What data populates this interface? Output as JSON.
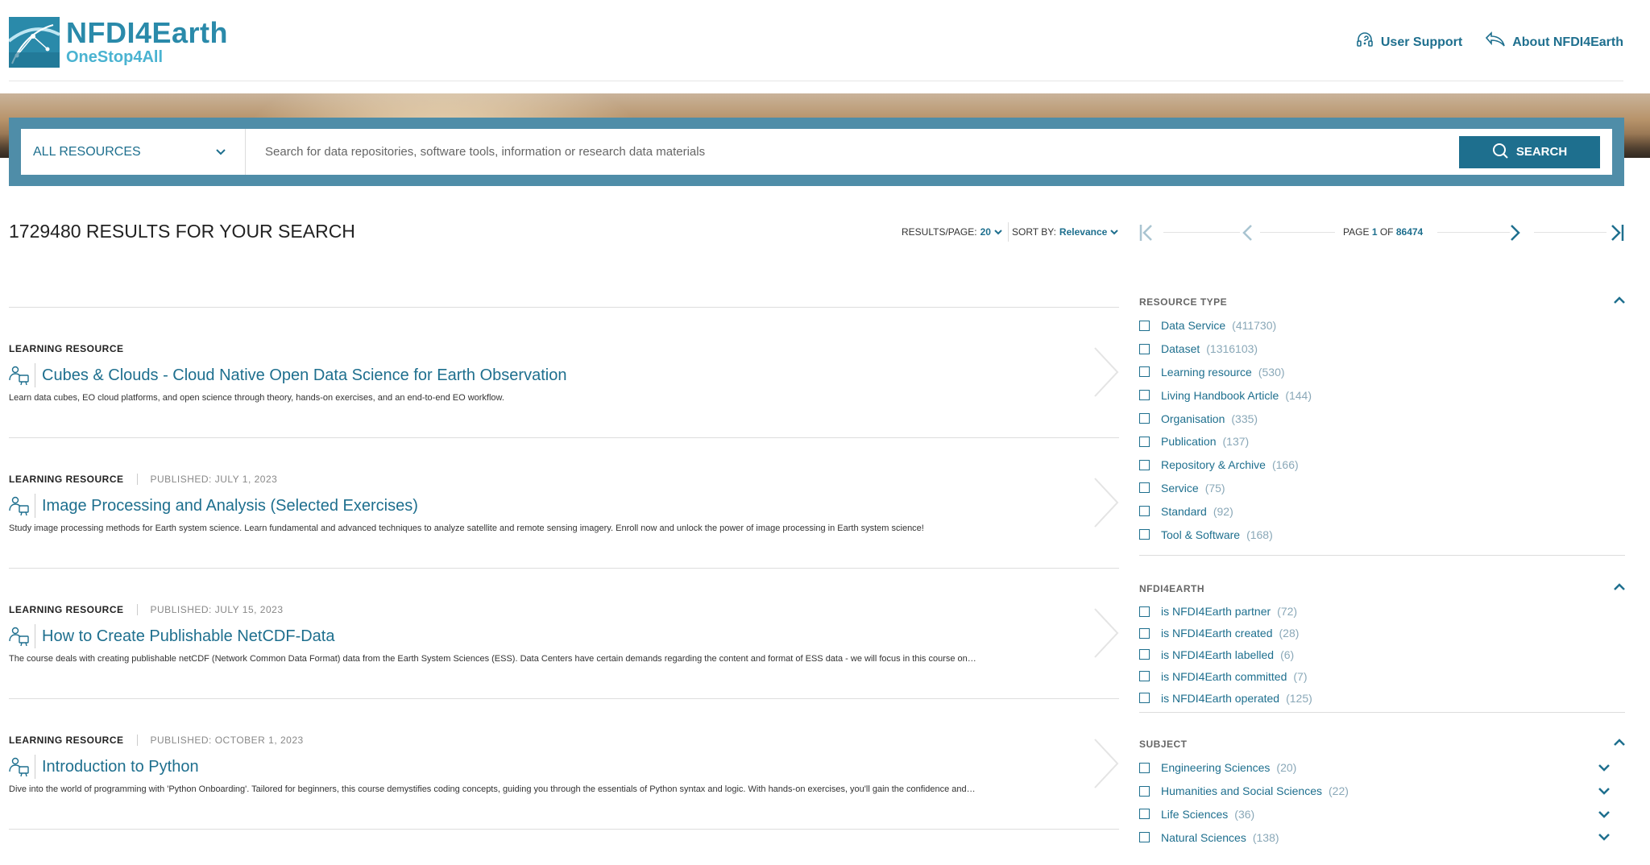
{
  "brand": {
    "name": "NFDI4Earth",
    "sub": "OneStop4All"
  },
  "nav": [
    {
      "label": "User Support",
      "icon": "headset-icon"
    },
    {
      "label": "About NFDI4Earth",
      "icon": "share-arrow-icon"
    }
  ],
  "search": {
    "scope": "ALL RESOURCES",
    "placeholder": "Search for data repositories, software tools, information or research data materials",
    "button": "SEARCH"
  },
  "results_summary": {
    "heading": "1729480 RESULTS FOR YOUR SEARCH",
    "per_page_label": "RESULTS/PAGE:",
    "per_page_value": "20",
    "sort_label": "SORT BY:",
    "sort_value": "Relevance",
    "page_label": "PAGE",
    "page_current": "1",
    "page_of": "OF",
    "page_total": "86474"
  },
  "results": [
    {
      "type": "LEARNING RESOURCE",
      "published": "",
      "title": "Cubes & Clouds - Cloud Native Open Data Science for Earth Observation",
      "description": "Learn data cubes, EO cloud platforms, and open science through theory, hands-on exercises, and an end-to-end EO workflow."
    },
    {
      "type": "LEARNING RESOURCE",
      "published": "PUBLISHED: JULY 1, 2023",
      "title": "Image Processing and Analysis (Selected Exercises)",
      "description": "Study image processing methods for Earth system science. Learn fundamental and advanced techniques to analyze satellite and remote sensing imagery. Enroll now and unlock the power of image processing in Earth system science!"
    },
    {
      "type": "LEARNING RESOURCE",
      "published": "PUBLISHED: JULY 15, 2023",
      "title": "How to Create Publishable NetCDF-Data",
      "description": "The course deals with creating publishable netCDF (Network Common Data Format) data from the Earth System Sciences (ESS). Data Centers have certain demands regarding the content and format of ESS data - we will focus in this course on…"
    },
    {
      "type": "LEARNING RESOURCE",
      "published": "PUBLISHED: OCTOBER 1, 2023",
      "title": "Introduction to Python",
      "description": "Dive into the world of programming with 'Python Onboarding'. Tailored for beginners, this course demystifies coding concepts, guiding you through the essentials of Python syntax and logic. With hands-on exercises, you'll gain the confidence and…"
    }
  ],
  "facets": {
    "resource_type": {
      "title": "RESOURCE TYPE",
      "items": [
        {
          "label": "Data Service",
          "count": "(411730)"
        },
        {
          "label": "Dataset",
          "count": "(1316103)"
        },
        {
          "label": "Learning resource",
          "count": "(530)"
        },
        {
          "label": "Living Handbook Article",
          "count": "(144)"
        },
        {
          "label": "Organisation",
          "count": "(335)"
        },
        {
          "label": "Publication",
          "count": "(137)"
        },
        {
          "label": "Repository & Archive",
          "count": "(166)"
        },
        {
          "label": "Service",
          "count": "(75)"
        },
        {
          "label": "Standard",
          "count": "(92)"
        },
        {
          "label": "Tool & Software",
          "count": "(168)"
        }
      ]
    },
    "nfdi4earth": {
      "title": "NFDI4EARTH",
      "items": [
        {
          "label": "is NFDI4Earth partner",
          "count": "(72)"
        },
        {
          "label": "is NFDI4Earth created",
          "count": "(28)"
        },
        {
          "label": "is NFDI4Earth labelled",
          "count": "(6)"
        },
        {
          "label": "is NFDI4Earth committed",
          "count": "(7)"
        },
        {
          "label": "is NFDI4Earth operated",
          "count": "(125)"
        }
      ]
    },
    "subject": {
      "title": "SUBJECT",
      "items": [
        {
          "label": "Engineering Sciences",
          "count": "(20)"
        },
        {
          "label": "Humanities and Social Sciences",
          "count": "(22)"
        },
        {
          "label": "Life Sciences",
          "count": "(36)"
        },
        {
          "label": "Natural Sciences",
          "count": "(138)"
        }
      ]
    }
  },
  "colors": {
    "accent": "#1e6f8e",
    "search_frame": "#4f8da8",
    "logo_blue": "#2a8aaa"
  }
}
